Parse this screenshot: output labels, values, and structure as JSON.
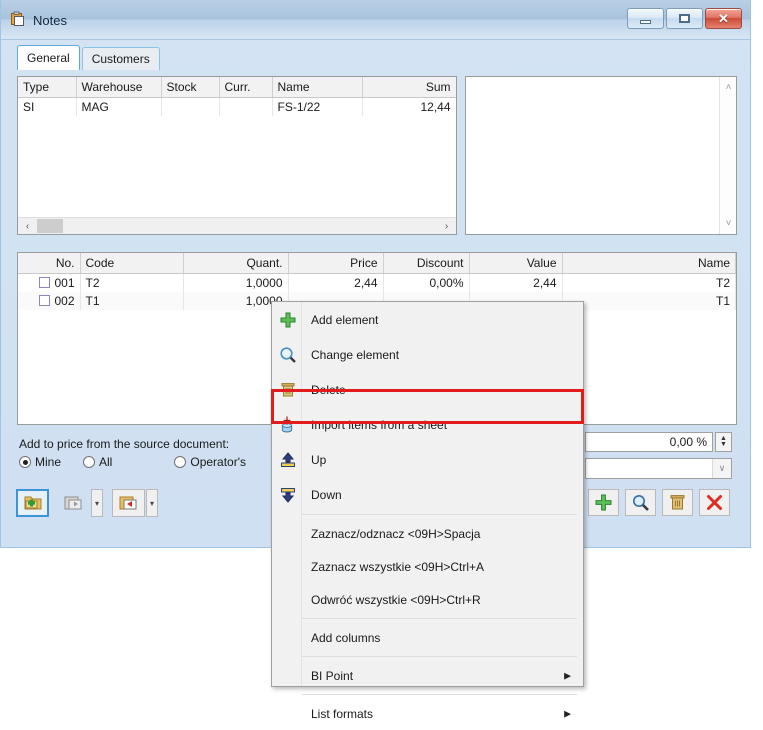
{
  "window": {
    "title": "Notes",
    "icon": "notes-clipboard-icon",
    "buttons": {
      "minimize": "–",
      "maximize": "□",
      "close": "✕"
    }
  },
  "tabs": [
    {
      "label": "General",
      "active": true
    },
    {
      "label": "Customers",
      "active": false
    }
  ],
  "header_grid": {
    "columns": [
      "Type",
      "Warehouse",
      "Stock",
      "Curr.",
      "Name",
      "Sum"
    ],
    "rows": [
      {
        "type": "SI",
        "warehouse": "MAG",
        "stock": "",
        "curr": "",
        "name": "FS-1/22",
        "sum": "12,44"
      }
    ],
    "scroll": {
      "left_arrow": "‹",
      "right_arrow": "›"
    }
  },
  "notes_box": {
    "value": "",
    "scroll_up": "˄",
    "scroll_down": "˅"
  },
  "items_grid": {
    "columns": [
      "No.",
      "Code",
      "Quant.",
      "Price",
      "Discount",
      "Value",
      "Name"
    ],
    "rows": [
      {
        "no": "001",
        "code": "T2",
        "quant": "1,0000",
        "price": "2,44",
        "discount": "0,00%",
        "value": "2,44",
        "name": "T2",
        "checked": false
      },
      {
        "no": "002",
        "code": "T1",
        "quant": "1,0000",
        "price": "",
        "discount": "",
        "value": "",
        "name": "T1",
        "checked": false
      }
    ]
  },
  "options": {
    "label": "Add to price from the source document:",
    "radios": [
      {
        "label": "Mine",
        "selected": true
      },
      {
        "label": "All",
        "selected": false
      },
      {
        "label": "Operator's",
        "selected": false
      }
    ]
  },
  "fields": {
    "percent_value": "0,00 %",
    "combo_value": "",
    "spin_up": "▲",
    "spin_down": "▼",
    "combo_arrow": "∨"
  },
  "toolbar_left": [
    {
      "icon": "add-folder-icon",
      "selected": true
    },
    {
      "icon": "paste-back-icon",
      "selected": false,
      "has_dropdown": true
    },
    {
      "icon": "paste-forward-icon",
      "selected": false,
      "has_dropdown": true
    }
  ],
  "toolbar_right": [
    {
      "icon": "plus-icon"
    },
    {
      "icon": "magnifier-icon"
    },
    {
      "icon": "trash-icon"
    },
    {
      "icon": "red-x-icon"
    }
  ],
  "context_menu": {
    "highlight_color": "#e21c1c",
    "highlighted_item": "Import items from a sheet",
    "items": [
      {
        "label": "Add element",
        "icon": "green-plus-icon",
        "submenu": false
      },
      {
        "label": "Change element",
        "icon": "magnifier-icon",
        "submenu": false
      },
      {
        "label": "Delete",
        "icon": "trash-icon",
        "submenu": false
      },
      {
        "label": "Import items from a sheet",
        "icon": "import-sheet-icon",
        "submenu": false
      },
      {
        "label": "Up",
        "icon": "arrow-up-icon",
        "submenu": false
      },
      {
        "label": "Down",
        "icon": "arrow-down-icon",
        "submenu": false
      },
      {
        "label": "Zaznacz/odznacz <09H>Spacja",
        "icon": "",
        "submenu": false
      },
      {
        "label": "Zaznacz wszystkie <09H>Ctrl+A",
        "icon": "",
        "submenu": false
      },
      {
        "label": "Odwróć wszystkie <09H>Ctrl+R",
        "icon": "",
        "submenu": false
      },
      {
        "label": "Add columns",
        "icon": "",
        "submenu": false
      },
      {
        "label": "BI Point",
        "icon": "",
        "submenu": true
      },
      {
        "label": "List formats",
        "icon": "",
        "submenu": true
      }
    ],
    "submenu_arrow": "▶"
  }
}
